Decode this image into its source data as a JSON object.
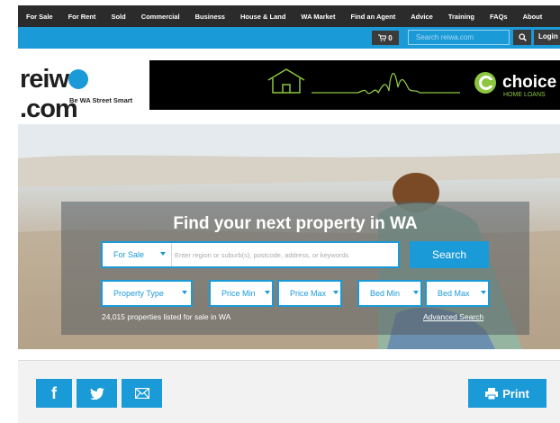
{
  "nav": {
    "items": [
      "For Sale",
      "For Rent",
      "Sold",
      "Commercial",
      "Business",
      "House & Land",
      "WA Market",
      "Find an Agent",
      "Advice",
      "Training",
      "FAQs",
      "About"
    ]
  },
  "header": {
    "cart_count": "0",
    "search_placeholder": "Search reiwa.com",
    "login_label": "Login"
  },
  "logo": {
    "name_a": "reiw",
    "name_b": "com",
    "tagline": "Be WA Street Smart"
  },
  "banner": {
    "brand": "choice",
    "subtitle": "HOME LOANS"
  },
  "hero": {
    "headline": "Find your next property in WA",
    "listing_type": "For Sale",
    "query_placeholder": "Enter region or suburb(s), postcode, address, or keywords",
    "search_label": "Search",
    "filters": {
      "property_type": "Property Type",
      "price_min": "Price Min",
      "price_max": "Price Max",
      "bed_min": "Bed Min",
      "bed_max": "Bed Max"
    },
    "listed_text": "24,015 properties listed for sale in WA",
    "advanced_search": "Advanced Search"
  },
  "share": {
    "facebook": "f",
    "print_label": "Print"
  },
  "colors": {
    "brand_blue": "#1b9ad8",
    "nav_dark": "#2b2b2b",
    "banner_green": "#8cc63f"
  }
}
